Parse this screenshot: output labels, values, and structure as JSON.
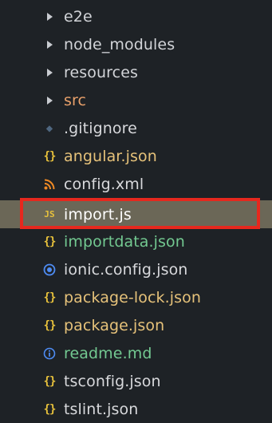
{
  "colors": {
    "background": "#1e2226",
    "selected_row": "#6b6757",
    "highlight_box": "#e6281e",
    "folder_text": "#d2d4d8",
    "src_text": "#e8a06a",
    "default_text": "#d8d9dc",
    "modified_text": "#e6c27a",
    "untracked_text": "#73c991"
  },
  "explorer": {
    "items": [
      {
        "label": "e2e",
        "kind": "folder",
        "icon": "chevron-right-icon"
      },
      {
        "label": "node_modules",
        "kind": "folder",
        "icon": "chevron-right-icon"
      },
      {
        "label": "resources",
        "kind": "folder",
        "icon": "chevron-right-icon"
      },
      {
        "label": "src",
        "kind": "folder",
        "icon": "chevron-right-icon"
      },
      {
        "label": ".gitignore",
        "kind": "file",
        "icon": "git-icon",
        "glyph": "◆"
      },
      {
        "label": "angular.json",
        "kind": "file",
        "icon": "json-icon",
        "glyph": "{}"
      },
      {
        "label": "config.xml",
        "kind": "file",
        "icon": "rss-icon",
        "glyph": "⌇"
      },
      {
        "label": "import.js",
        "kind": "file",
        "icon": "javascript-icon",
        "glyph": "JS",
        "selected": true
      },
      {
        "label": "importdata.json",
        "kind": "file",
        "icon": "json-icon",
        "glyph": "{}"
      },
      {
        "label": "ionic.config.json",
        "kind": "file",
        "icon": "ionic-icon",
        "glyph": "◉"
      },
      {
        "label": "package-lock.json",
        "kind": "file",
        "icon": "json-icon",
        "glyph": "{}"
      },
      {
        "label": "package.json",
        "kind": "file",
        "icon": "json-icon",
        "glyph": "{}"
      },
      {
        "label": "readme.md",
        "kind": "file",
        "icon": "info-icon",
        "glyph": "ⓘ"
      },
      {
        "label": "tsconfig.json",
        "kind": "file",
        "icon": "json-icon",
        "glyph": "{}"
      },
      {
        "label": "tslint.json",
        "kind": "file",
        "icon": "json-icon",
        "glyph": "{}"
      }
    ]
  }
}
